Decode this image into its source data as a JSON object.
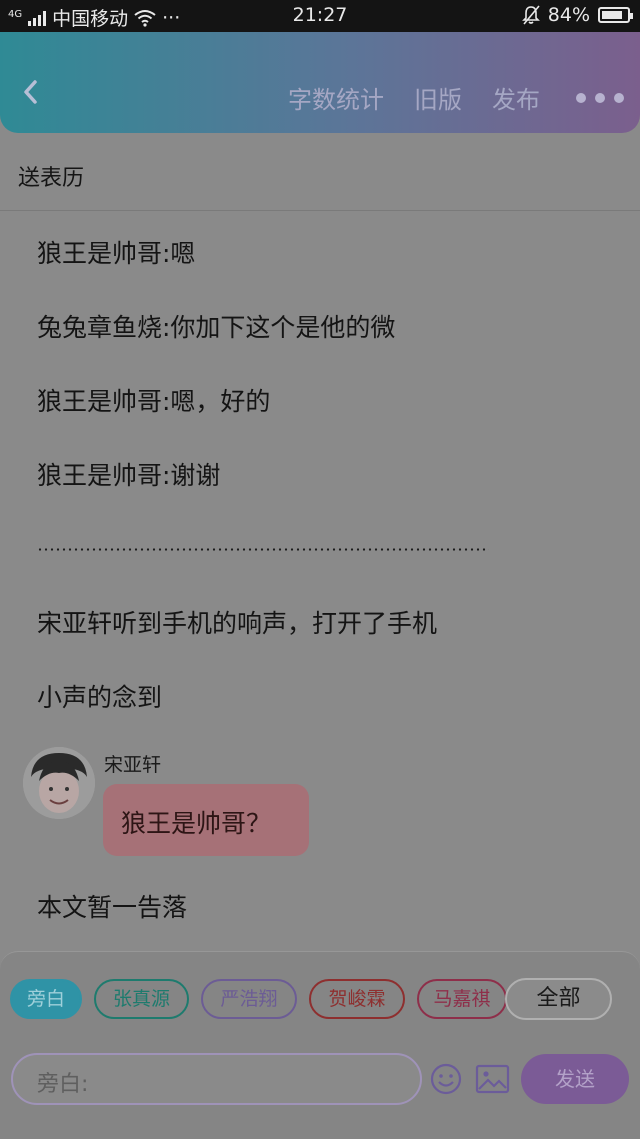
{
  "status_bar": {
    "network": "4G",
    "carrier": "中国移动",
    "more": "···",
    "time": "21:27",
    "battery": "84%",
    "battery_level": 0.84
  },
  "header": {
    "actions": [
      "字数统计",
      "旧版",
      "发布"
    ]
  },
  "document": {
    "title": "送表历",
    "lines": [
      "狼王是帅哥:嗯",
      "兔兔章鱼烧:你加下这个是他的微",
      "狼王是帅哥:嗯，好的",
      "狼王是帅哥:谢谢",
      "宋亚轩听到手机的响声，打开了手机",
      "小声的念到"
    ],
    "dialogue": {
      "speaker": "宋亚轩",
      "text": "狼王是帅哥？"
    },
    "ending": "本文暂一告落"
  },
  "composer": {
    "roles": [
      {
        "label": "旁白",
        "color": "#2f93a6",
        "filled": true
      },
      {
        "label": "张真源",
        "color": "#1e7b6e",
        "filled": false
      },
      {
        "label": "严浩翔",
        "color": "#6c5c95",
        "filled": false
      },
      {
        "label": "贺峻霖",
        "color": "#8e2f2f",
        "filled": false
      },
      {
        "label": "马嘉祺",
        "color": "#8e2f4a",
        "filled": false
      }
    ],
    "all_label": "全部",
    "input_placeholder": "旁白:",
    "send_label": "发送"
  }
}
